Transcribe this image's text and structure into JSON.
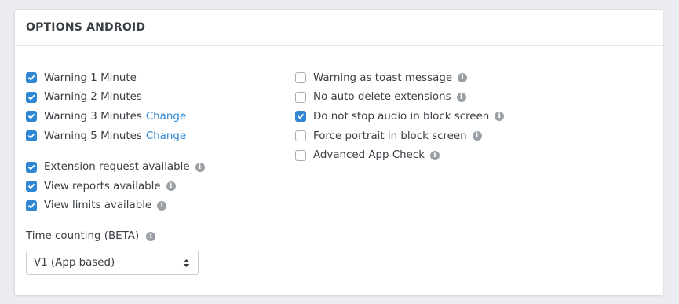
{
  "panel": {
    "title": "OPTIONS ANDROID"
  },
  "left_options": [
    {
      "label": "Warning 1 Minute",
      "checked": true
    },
    {
      "label": "Warning 2 Minutes",
      "checked": true
    },
    {
      "label": "Warning 3 Minutes",
      "checked": true,
      "link": "Change"
    },
    {
      "label": "Warning 5 Minutes",
      "checked": true,
      "link": "Change"
    },
    {
      "label": "Extension request available",
      "checked": true,
      "info": true
    },
    {
      "label": "View reports available",
      "checked": true,
      "info": true
    },
    {
      "label": "View limits available",
      "checked": true,
      "info": true
    }
  ],
  "right_options": [
    {
      "label": "Warning as toast message",
      "checked": false,
      "info": true
    },
    {
      "label": "No auto delete extensions",
      "checked": false,
      "info": true
    },
    {
      "label": "Do not stop audio in block screen",
      "checked": true,
      "info": true
    },
    {
      "label": "Force portrait in block screen",
      "checked": false,
      "info": true
    },
    {
      "label": "Advanced App Check",
      "checked": false,
      "info": true
    }
  ],
  "time_counting": {
    "label": "Time counting (BETA)",
    "selected": "V1 (App based)"
  },
  "colors": {
    "accent": "#2f86d3",
    "info_icon": "#9aa0a6",
    "background": "#eaecf1"
  },
  "icons": {
    "checkbox_tick": "check-icon",
    "info": "info-icon",
    "select_caret": "sort-caret-icon"
  }
}
